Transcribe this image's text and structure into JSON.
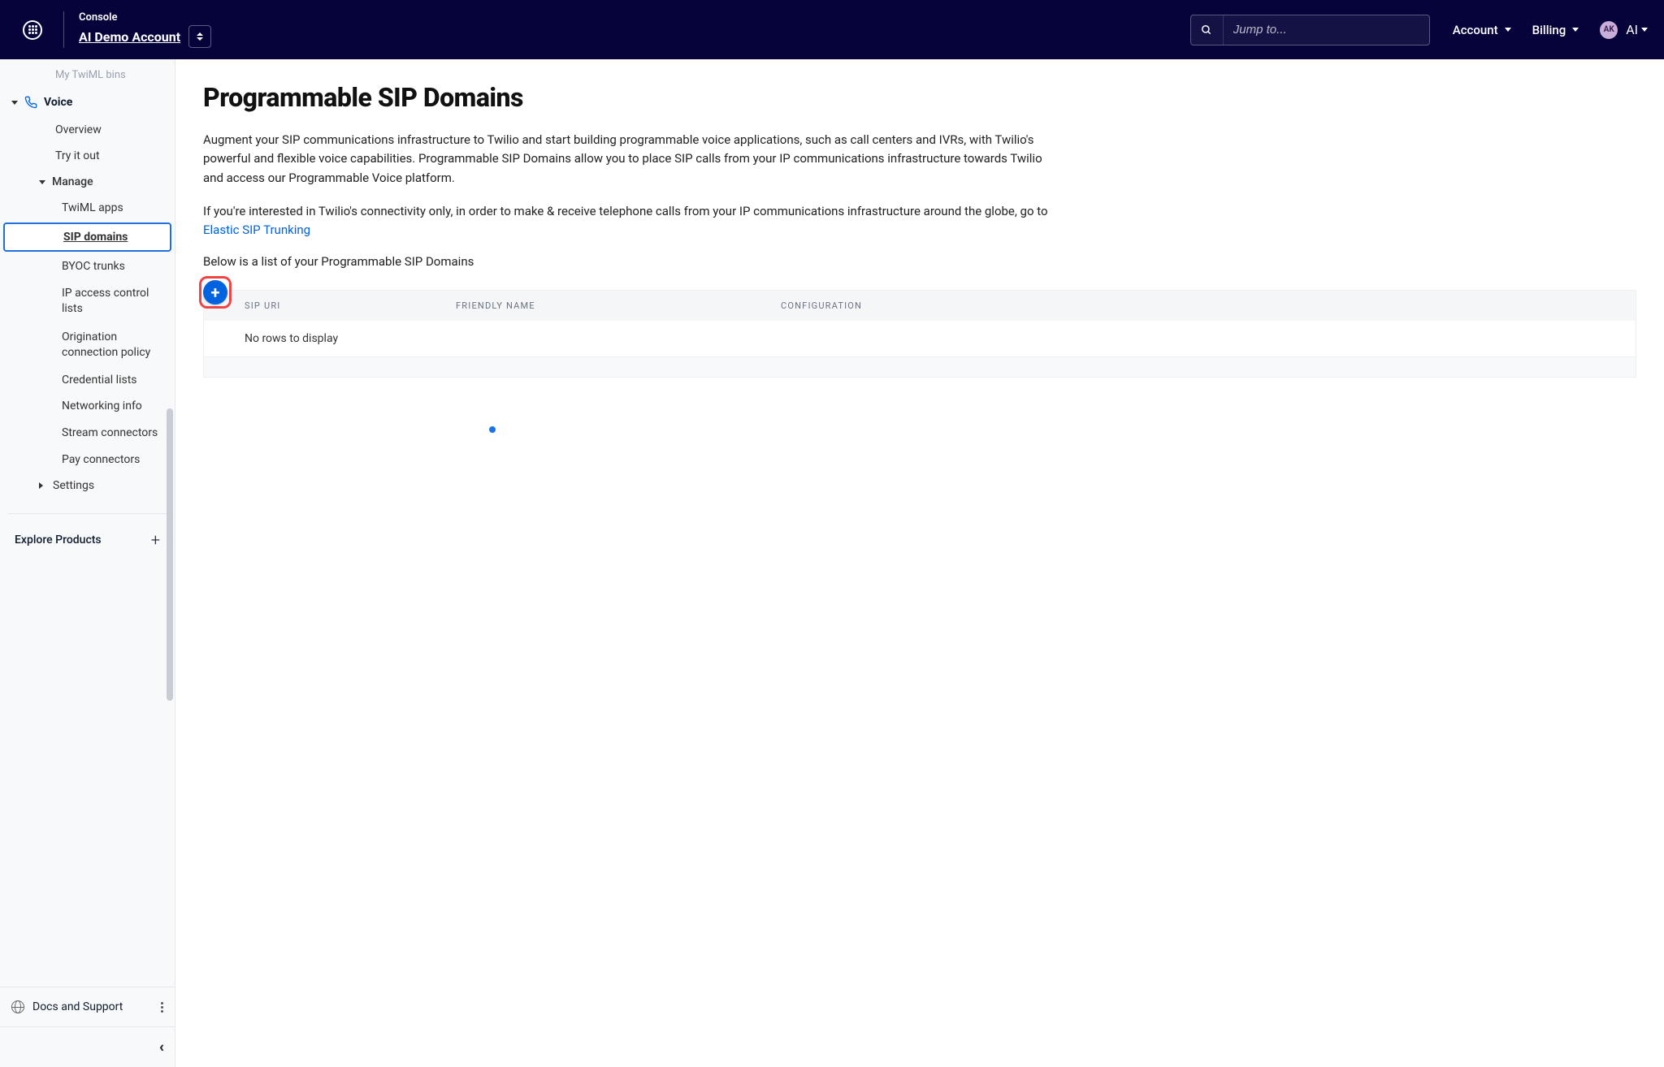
{
  "header": {
    "console_label": "Console",
    "account_name": "AI Demo Account",
    "search_placeholder": "Jump to...",
    "account_link": "Account",
    "billing_link": "Billing",
    "user_initials": "AK",
    "user_label": "AI"
  },
  "sidebar": {
    "prev_item": "My TwiML bins",
    "voice_section": "Voice",
    "items": {
      "overview": "Overview",
      "try": "Try it out",
      "manage": "Manage",
      "twiml": "TwiML apps",
      "sip": "SIP domains",
      "byoc": "BYOC trunks",
      "ipacl": "IP access control lists",
      "origin": "Origination connection policy",
      "cred": "Credential lists",
      "net": "Networking info",
      "stream": "Stream connectors",
      "pay": "Pay connectors",
      "settings": "Settings"
    },
    "explore": "Explore Products",
    "docs": "Docs and Support"
  },
  "main": {
    "title": "Programmable SIP Domains",
    "para1": "Augment your SIP communications infrastructure to Twilio and start building programmable voice applications, such as call centers and IVRs, with Twilio's powerful and flexible voice capabilities. Programmable SIP Domains allow you to place SIP calls from your IP communications infrastructure towards Twilio and access our Programmable Voice platform.",
    "para2_a": "If you're interested in Twilio's connectivity only, in order to make & receive telephone calls from your IP communications infrastructure around the globe, go to ",
    "para2_link": "Elastic SIP Trunking",
    "subhead": "Below is a list of your Programmable SIP Domains",
    "table": {
      "col_sip": "SIP URI",
      "col_friendly": "FRIENDLY NAME",
      "col_config": "CONFIGURATION",
      "empty": "No rows to display"
    },
    "add_label": "+"
  }
}
